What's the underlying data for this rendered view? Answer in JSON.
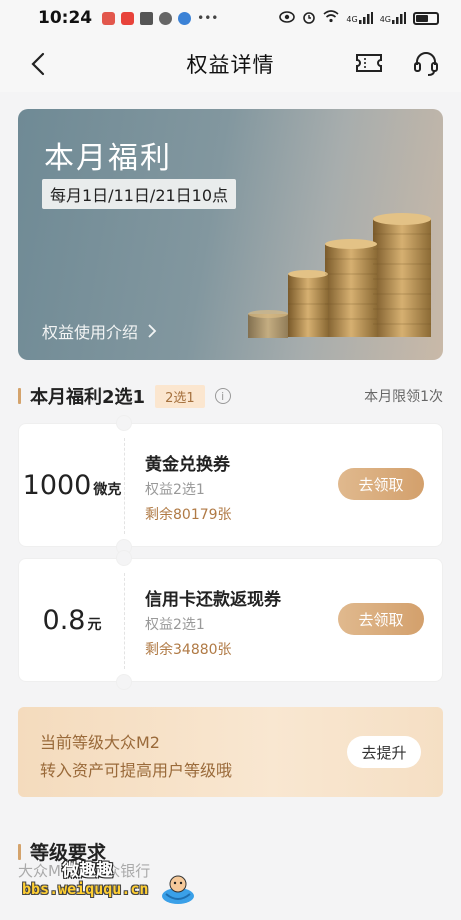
{
  "status_bar": {
    "time": "10:24",
    "signal_1": "4G",
    "signal_2": "4G"
  },
  "nav": {
    "title": "权益详情"
  },
  "banner": {
    "title": "本月福利",
    "schedule": "每月1日/11日/21日10点",
    "link_label": "权益使用介绍"
  },
  "section": {
    "title": "本月福利2选1",
    "chip": "2选1",
    "note": "本月限领1次"
  },
  "benefits": [
    {
      "amount": "1000",
      "unit": "微克",
      "name": "黄金兑换券",
      "sub": "权益2选1",
      "remaining": "剩余80179张",
      "button": "去领取"
    },
    {
      "amount": "0.8",
      "unit": "元",
      "name": "信用卡还款返现券",
      "sub": "权益2选1",
      "remaining": "剩余34880张",
      "button": "去领取"
    }
  ],
  "upgrade": {
    "line1": "当前等级大众M2",
    "line2": "转入资产可提高用户等级哦",
    "button": "去提升"
  },
  "level": {
    "title": "等级要求",
    "partial_text": "大众M1 日大众银行"
  },
  "watermark": {
    "top": "微趣趣",
    "url": "bbs.weiququ.cn"
  }
}
